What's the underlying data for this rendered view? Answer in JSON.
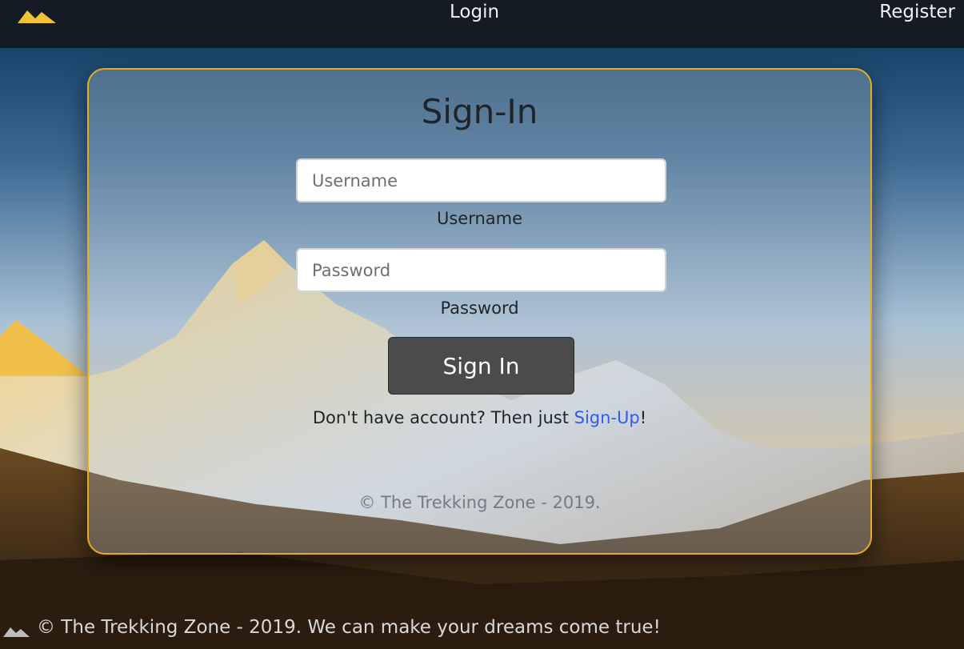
{
  "nav": {
    "logo_icon": "mountain-logo-icon",
    "login_label": "Login",
    "register_label": "Register"
  },
  "signin": {
    "title": "Sign-In",
    "username_placeholder": "Username",
    "username_label": "Username",
    "password_placeholder": "Password",
    "password_label": "Password",
    "button_label": "Sign In",
    "signup_prefix": "Don't have account? Then just ",
    "signup_link": "Sign-Up",
    "signup_suffix": "!",
    "copyright": "© The Trekking Zone - 2019."
  },
  "footer": {
    "icon": "mountain-icon",
    "text": "© The Trekking Zone - 2019. We can make your dreams come true!"
  },
  "colors": {
    "accent": "#e3ad1e",
    "nav_bg": "#151b24",
    "button_bg": "#4b4b4b",
    "link": "#2f5bf0"
  }
}
